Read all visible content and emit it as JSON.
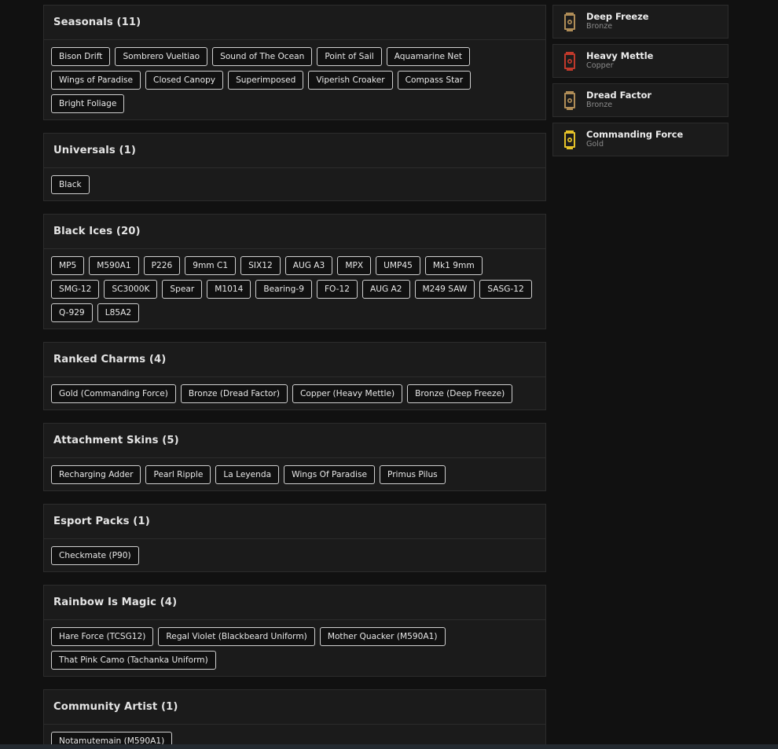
{
  "sections": [
    {
      "title": "Seasonals (11)",
      "items": [
        "Bison Drift",
        "Sombrero Vueltiao",
        "Sound of The Ocean",
        "Point of Sail",
        "Aquamarine Net",
        "Wings of Paradise",
        "Closed Canopy",
        "Superimposed",
        "Viperish Croaker",
        "Compass Star",
        "Bright Foliage"
      ]
    },
    {
      "title": "Universals (1)",
      "items": [
        "Black"
      ]
    },
    {
      "title": "Black Ices (20)",
      "items": [
        "MP5",
        "M590A1",
        "P226",
        "9mm C1",
        "SIX12",
        "AUG A3",
        "MPX",
        "UMP45",
        "Mk1 9mm",
        "SMG-12",
        "SC3000K",
        "Spear",
        "M1014",
        "Bearing-9",
        "FO-12",
        "AUG A2",
        "M249 SAW",
        "SASG-12",
        "Q-929",
        "L85A2"
      ]
    },
    {
      "title": "Ranked Charms (4)",
      "items": [
        "Gold (Commanding Force)",
        "Bronze (Dread Factor)",
        "Copper (Heavy Mettle)",
        "Bronze (Deep Freeze)"
      ]
    },
    {
      "title": "Attachment Skins (5)",
      "items": [
        "Recharging Adder",
        "Pearl Ripple",
        "La Leyenda",
        "Wings Of Paradise",
        "Primus Pilus"
      ]
    },
    {
      "title": "Esport Packs (1)",
      "items": [
        "Checkmate (P90)"
      ]
    },
    {
      "title": "Rainbow Is Magic (4)",
      "items": [
        "Hare Force (TCSG12)",
        "Regal Violet (Blackbeard Uniform)",
        "Mother Quacker (M590A1)",
        "That Pink Camo (Tachanka Uniform)"
      ]
    },
    {
      "title": "Community Artist (1)",
      "items": [
        "Notamutemain (M590A1)"
      ]
    }
  ],
  "charms": [
    {
      "name": "Deep Freeze",
      "tier": "Bronze",
      "icon": "bronze-charm-icon",
      "color": "#b08d57"
    },
    {
      "name": "Heavy Mettle",
      "tier": "Copper",
      "icon": "copper-charm-icon",
      "color": "#c0392b"
    },
    {
      "name": "Dread Factor",
      "tier": "Bronze",
      "icon": "bronze-charm-icon",
      "color": "#b08d57"
    },
    {
      "name": "Commanding Force",
      "tier": "Gold",
      "icon": "gold-charm-icon",
      "color": "#e6c229"
    }
  ]
}
